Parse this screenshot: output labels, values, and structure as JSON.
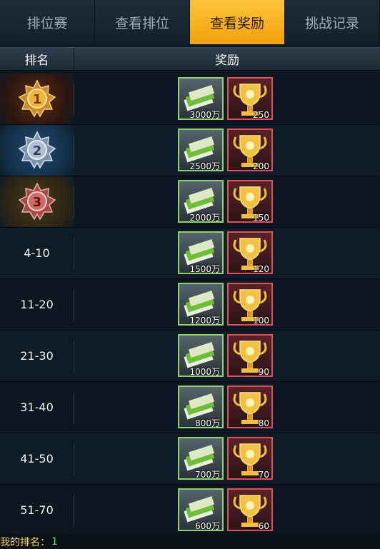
{
  "tabs": [
    {
      "label": "排位赛",
      "active": false
    },
    {
      "label": "查看排位",
      "active": false
    },
    {
      "label": "查看奖励",
      "active": true
    },
    {
      "label": "挑战记录",
      "active": false
    }
  ],
  "table": {
    "col_rank": "排名",
    "col_reward": "奖励"
  },
  "rows": [
    {
      "rank": "1",
      "medal": "gold-medal-icon",
      "money": "3000万",
      "trophy": "250"
    },
    {
      "rank": "2",
      "medal": "silver-medal-icon",
      "money": "2500万",
      "trophy": "200"
    },
    {
      "rank": "3",
      "medal": "bronze-medal-icon",
      "money": "2000万",
      "trophy": "150"
    },
    {
      "rank": "4-10",
      "money": "1500万",
      "trophy": "120"
    },
    {
      "rank": "11-20",
      "money": "1200万",
      "trophy": "100"
    },
    {
      "rank": "21-30",
      "money": "1000万",
      "trophy": "90"
    },
    {
      "rank": "31-40",
      "money": "800万",
      "trophy": "80"
    },
    {
      "rank": "41-50",
      "money": "700万",
      "trophy": "70"
    },
    {
      "rank": "51-70",
      "money": "600万",
      "trophy": "60"
    }
  ],
  "footer": {
    "label": "我的排名：",
    "value": "1"
  },
  "colors": {
    "accent": "#f5ae1e",
    "money_border": "#8ed36c",
    "trophy_border": "#e0505c"
  }
}
